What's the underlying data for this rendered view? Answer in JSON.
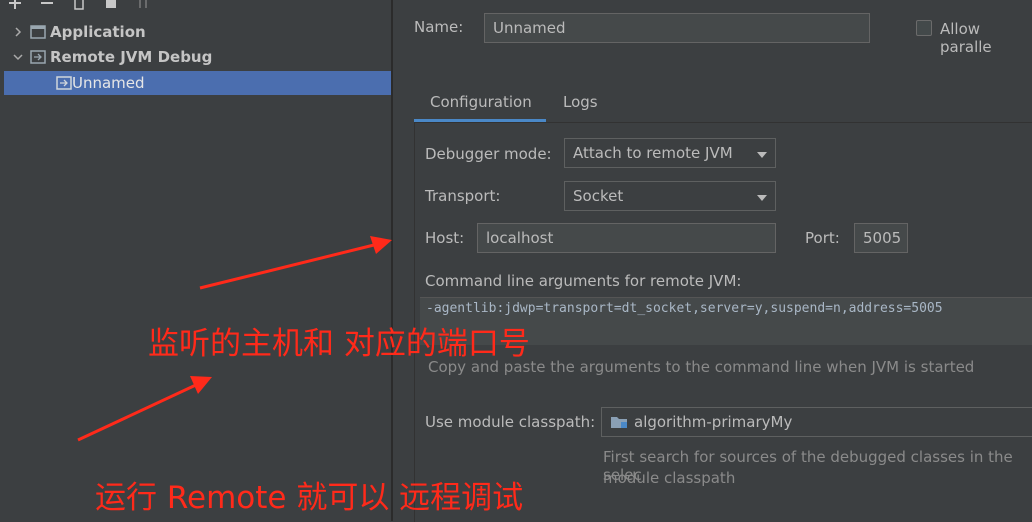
{
  "tree": {
    "items": [
      {
        "label": "Application",
        "expanded": false,
        "icon": "application-config-icon"
      },
      {
        "label": "Remote JVM Debug",
        "expanded": true,
        "icon": "remote-debug-icon"
      },
      {
        "label": "Unnamed",
        "selected": true,
        "icon": "remote-debug-icon"
      }
    ]
  },
  "form": {
    "name_label": "Name:",
    "name_value": "Unnamed",
    "allow_parallel_label": "Allow paralle",
    "tabs": [
      {
        "label": "Configuration",
        "active": true
      },
      {
        "label": "Logs",
        "active": false
      }
    ],
    "debugger_mode_label": "Debugger mode:",
    "debugger_mode_value": "Attach to remote JVM",
    "transport_label": "Transport:",
    "transport_value": "Socket",
    "host_label": "Host:",
    "host_value": "localhost",
    "port_label": "Port:",
    "port_value": "5005",
    "cmd_label": "Command line arguments for remote JVM:",
    "cmd_value": "-agentlib:jdwp=transport=dt_socket,server=y,suspend=n,address=5005",
    "cmd_hint": "Copy and paste the arguments to the command line when JVM is started",
    "module_label": "Use module classpath:",
    "module_value": "algorithm-primaryMy",
    "module_hint_line1": "First search for sources of the debugged classes in the selec",
    "module_hint_line2": "module classpath"
  },
  "annotations": {
    "text1": "监听的主机和 对应的端口号",
    "text2": "运行 Remote 就可以 远程调试",
    "color": "#ff2a1a"
  },
  "colors": {
    "background": "#3c3f41",
    "selection": "#4b6eaf",
    "tab_underline": "#4a88c7"
  }
}
